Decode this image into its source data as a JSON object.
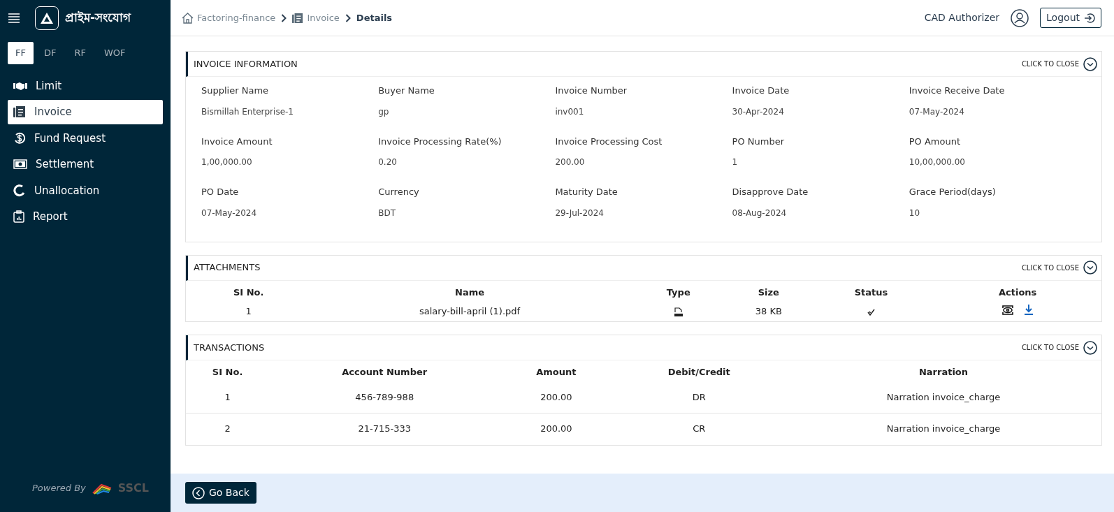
{
  "brand": {
    "name": "প্রাইম-সংযোগ"
  },
  "module_tabs": [
    {
      "label": "FF",
      "selected": true
    },
    {
      "label": "DF",
      "selected": false
    },
    {
      "label": "RF",
      "selected": false
    },
    {
      "label": "WOF",
      "selected": false
    }
  ],
  "sidebar": {
    "items": [
      {
        "label": "Limit",
        "selected": false
      },
      {
        "label": "Invoice",
        "selected": true
      },
      {
        "label": "Fund Request",
        "selected": false
      },
      {
        "label": "Settlement",
        "selected": false
      },
      {
        "label": "Unallocation",
        "selected": false
      },
      {
        "label": "Report",
        "selected": false
      }
    ]
  },
  "credit": {
    "text": "Powered By",
    "brand": "SSCL"
  },
  "breadcrumb": [
    {
      "label": "Factoring-finance"
    },
    {
      "label": "Invoice"
    },
    {
      "label": "Details"
    }
  ],
  "user": {
    "name": "CAD Authorizer"
  },
  "logout": "Logout",
  "invoice_information": {
    "title": "INVOICE INFORMATION",
    "toggle": "CLICK TO CLOSE",
    "fields": [
      {
        "label": "Supplier Name",
        "value": "Bismillah Enterprise-1"
      },
      {
        "label": "Buyer Name",
        "value": "gp"
      },
      {
        "label": "Invoice Number",
        "value": "inv001"
      },
      {
        "label": "Invoice Date",
        "value": "30-Apr-2024"
      },
      {
        "label": "Invoice Receive Date",
        "value": "07-May-2024"
      },
      {
        "label": "Invoice Amount",
        "value": "1,00,000.00"
      },
      {
        "label": "Invoice Processing Rate(%)",
        "value": "0.20"
      },
      {
        "label": "Invoice Processing Cost",
        "value": "200.00"
      },
      {
        "label": "PO Number",
        "value": "1"
      },
      {
        "label": "PO Amount",
        "value": "10,00,000.00"
      },
      {
        "label": "PO Date",
        "value": "07-May-2024"
      },
      {
        "label": "Currency",
        "value": "BDT"
      },
      {
        "label": "Maturity Date",
        "value": "29-Jul-2024"
      },
      {
        "label": "Disapprove Date",
        "value": "08-Aug-2024"
      },
      {
        "label": "Grace Period(days)",
        "value": "10"
      }
    ]
  },
  "attachments": {
    "title": "ATTACHMENTS",
    "toggle": "CLICK TO CLOSE",
    "columns": [
      "SI No.",
      "Name",
      "Type",
      "Size",
      "Status",
      "Actions"
    ],
    "rows": [
      {
        "sl": "1",
        "name": "salary-bill-april (1).pdf",
        "size": "38 KB"
      }
    ]
  },
  "transactions": {
    "title": "TRANSACTIONS",
    "toggle": "CLICK TO CLOSE",
    "columns": [
      "SI No.",
      "Account Number",
      "Amount",
      "Debit/Credit",
      "Narration"
    ],
    "rows": [
      {
        "sl": "1",
        "account": "456-789-988",
        "amount": "200.00",
        "dc": "DR",
        "narration": "Narration invoice_charge"
      },
      {
        "sl": "2",
        "account": "21-715-333",
        "amount": "200.00",
        "dc": "CR",
        "narration": "Narration invoice_charge"
      }
    ]
  },
  "go_back": "Go Back"
}
